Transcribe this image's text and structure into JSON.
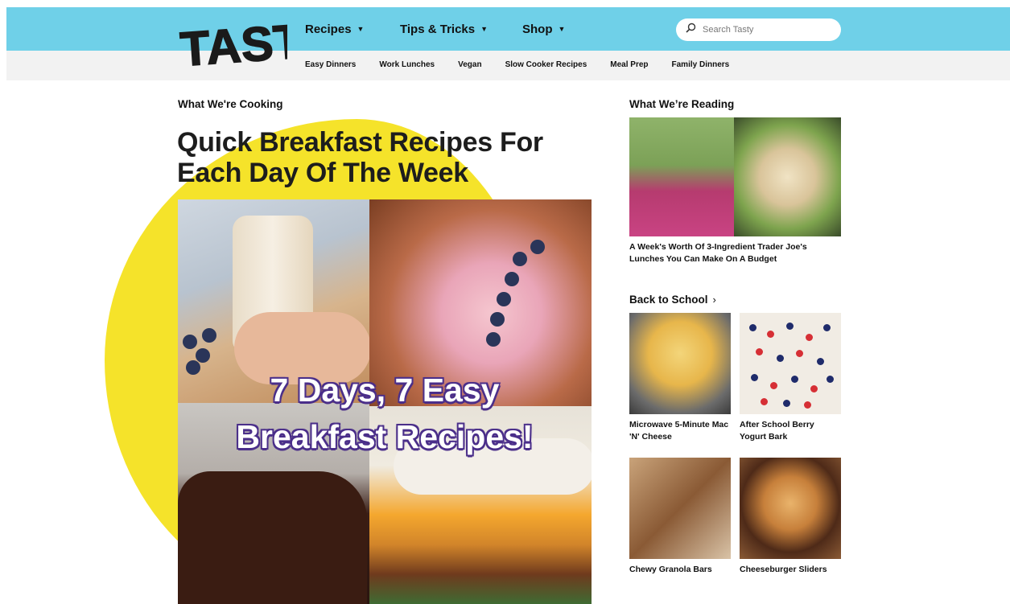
{
  "header": {
    "logo_text": "TASTY",
    "nav": [
      {
        "label": "Recipes"
      },
      {
        "label": "Tips & Tricks"
      },
      {
        "label": "Shop"
      }
    ],
    "search_placeholder": "Search Tasty",
    "sub_nav": [
      "Easy Dinners",
      "Work Lunches",
      "Vegan",
      "Slow Cooker Recipes",
      "Meal Prep",
      "Family Dinners"
    ]
  },
  "main": {
    "section_label": "What We're Cooking",
    "title": "Quick Breakfast Recipes For Each Day Of The Week",
    "image_text_line1": "7 Days, 7 Easy",
    "image_text_line2": "Breakfast Recipes!"
  },
  "sidebar": {
    "reading_label": "What We’re Reading",
    "reading_title": "A Week's Worth Of 3-Ingredient Trader Joe's Lunches You Can Make On A Budget",
    "school_label": "Back to School",
    "school_items": [
      {
        "title": "Microwave 5-Minute Mac 'N' Cheese"
      },
      {
        "title": "After School Berry Yogurt Bark"
      },
      {
        "title": "Chewy Granola Bars"
      },
      {
        "title": "Cheeseburger Sliders"
      }
    ]
  },
  "colors": {
    "header_bg": "#6fd0e8",
    "subnav_bg": "#f2f2f2",
    "accent_yellow": "#f5e32a",
    "text_outline": "#4b2f8a"
  }
}
